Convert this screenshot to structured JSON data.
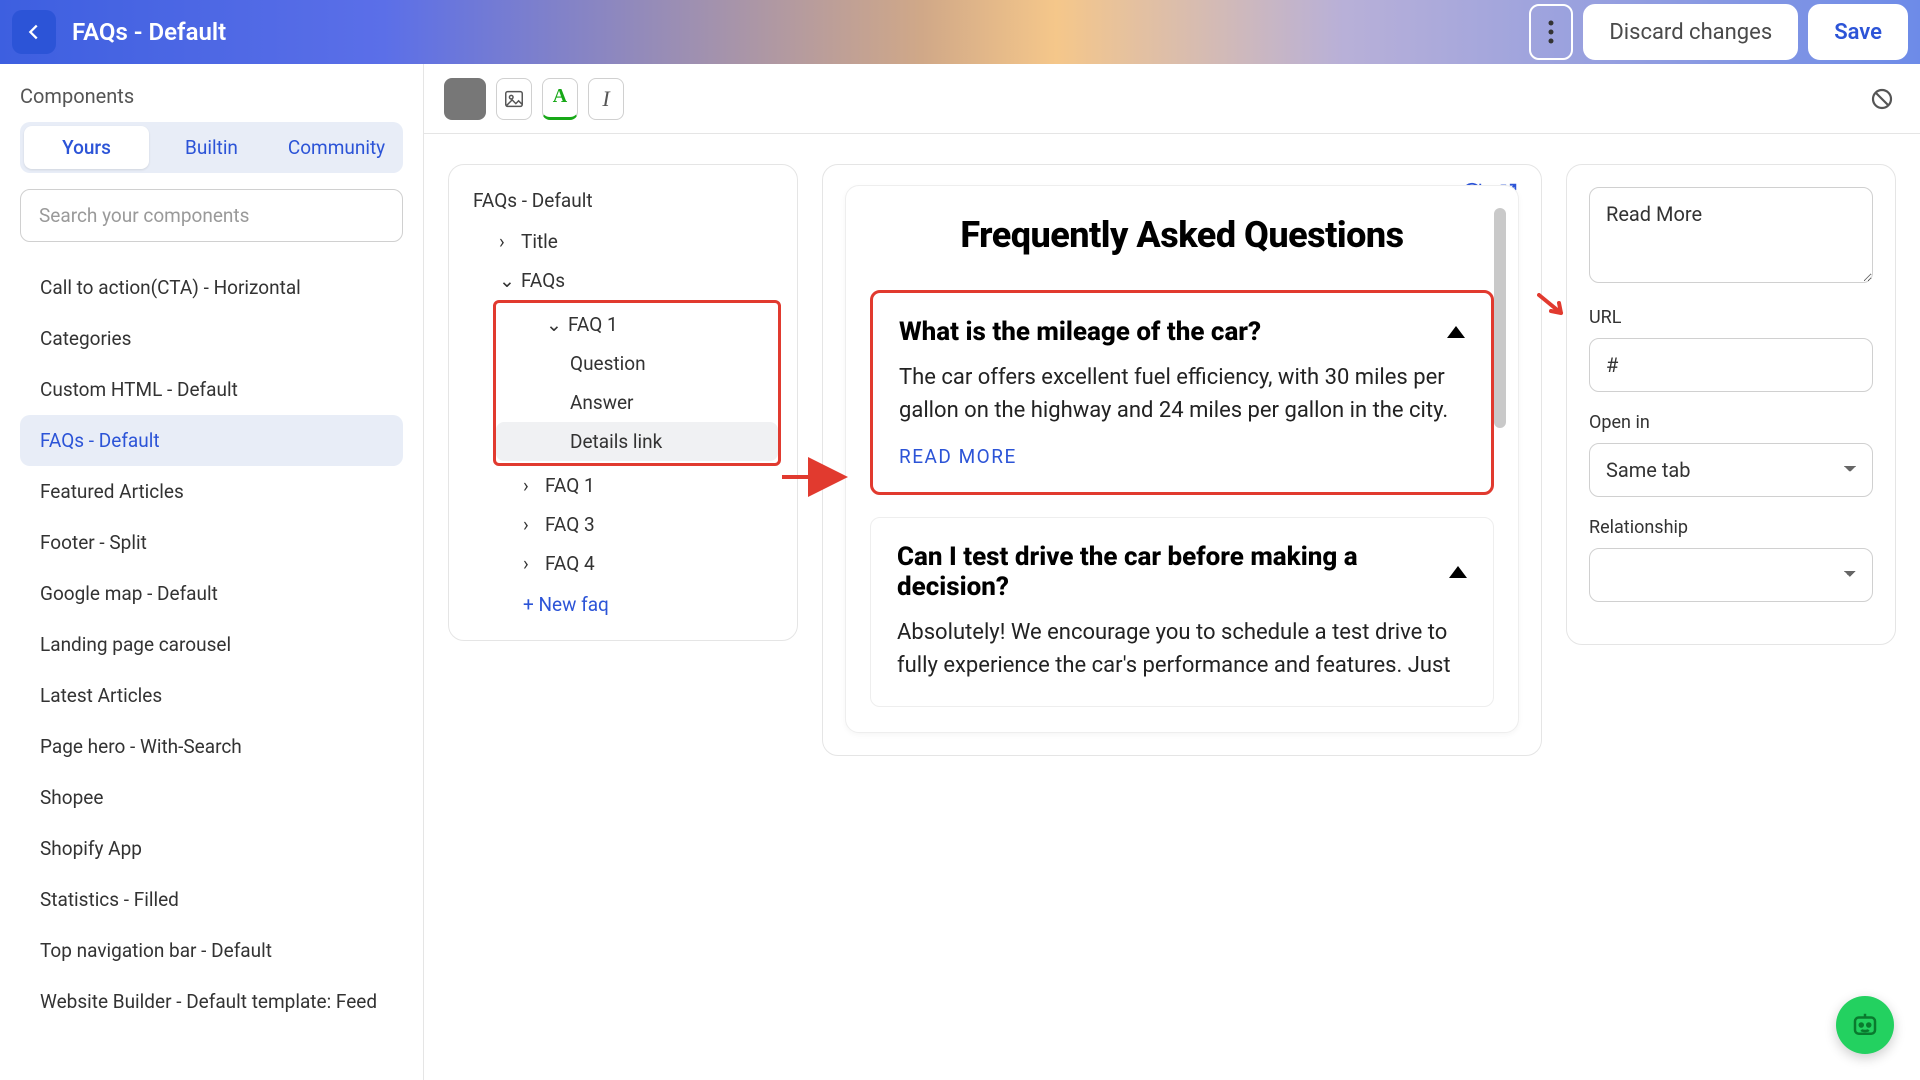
{
  "header": {
    "title": "FAQs - Default",
    "discard_label": "Discard changes",
    "save_label": "Save"
  },
  "sidebar": {
    "title": "Components",
    "tabs": {
      "yours": "Yours",
      "builtin": "Builtin",
      "community": "Community"
    },
    "search_placeholder": "Search your components",
    "items": [
      "Call to action(CTA) - Horizontal",
      "Categories",
      "Custom HTML - Default",
      "FAQs - Default",
      "Featured Articles",
      "Footer - Split",
      "Google map - Default",
      "Landing page carousel",
      "Latest Articles",
      "Page hero - With-Search",
      "Shopee",
      "Shopify App",
      "Statistics - Filled",
      "Top navigation bar - Default",
      "Website Builder - Default template: Feed"
    ],
    "active_index": 3
  },
  "outline": {
    "root": "FAQs - Default",
    "title_node": "Title",
    "faqs_node": "FAQs",
    "faq1_open": {
      "label": "FAQ 1",
      "question": "Question",
      "answer": "Answer",
      "details": "Details link"
    },
    "rest": [
      "FAQ 1",
      "FAQ 3",
      "FAQ 4"
    ],
    "new_faq": "New faq"
  },
  "preview": {
    "heading": "Frequently Asked Questions",
    "faqs": [
      {
        "q": "What is the mileage of the car?",
        "a": "The car offers excellent fuel efficiency, with 30 miles per gallon on the highway and 24 miles per gallon in the city.",
        "link": "READ MORE"
      },
      {
        "q": "Can I test drive the car before making a decision?",
        "a": "Absolutely! We encourage you to schedule a test drive to fully experience the car's performance and features. Just"
      }
    ]
  },
  "props": {
    "read_more_value": "Read More",
    "url_label": "URL",
    "url_value": "#",
    "open_in_label": "Open in",
    "open_in_value": "Same tab",
    "relationship_label": "Relationship",
    "relationship_value": ""
  }
}
